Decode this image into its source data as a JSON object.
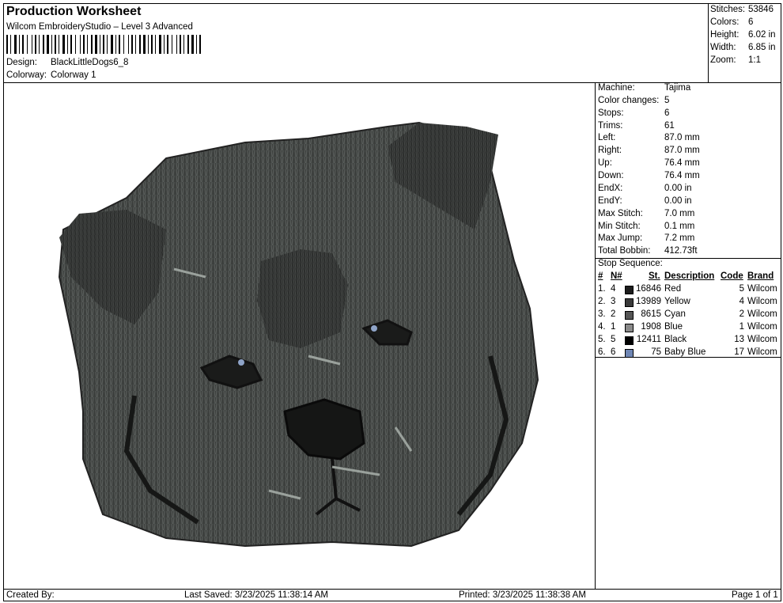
{
  "header": {
    "title": "Production Worksheet",
    "software": "Wilcom EmbroideryStudio – Level 3 Advanced",
    "design_label": "Design:",
    "design_value": "BlackLittleDogs6_8",
    "colorway_label": "Colorway:",
    "colorway_value": "Colorway 1"
  },
  "summary": [
    {
      "label": "Stitches:",
      "value": "53846"
    },
    {
      "label": "Colors:",
      "value": "6"
    },
    {
      "label": "Height:",
      "value": "6.02 in"
    },
    {
      "label": "Width:",
      "value": "6.85 in"
    },
    {
      "label": "Zoom:",
      "value": "1:1"
    }
  ],
  "machine_info": [
    {
      "label": "Machine:",
      "value": "Tajima"
    },
    {
      "label": "Color changes:",
      "value": "5"
    },
    {
      "label": "Stops:",
      "value": "6"
    },
    {
      "label": "Trims:",
      "value": "61"
    },
    {
      "label": "Left:",
      "value": "87.0 mm"
    },
    {
      "label": "Right:",
      "value": "87.0 mm"
    },
    {
      "label": "Up:",
      "value": "76.4 mm"
    },
    {
      "label": "Down:",
      "value": "76.4 mm"
    },
    {
      "label": "EndX:",
      "value": "0.00 in"
    },
    {
      "label": "EndY:",
      "value": "0.00 in"
    },
    {
      "label": "Max Stitch:",
      "value": "7.0 mm"
    },
    {
      "label": "Min Stitch:",
      "value": "0.1 mm"
    },
    {
      "label": "Max Jump:",
      "value": "7.2 mm"
    },
    {
      "label": "Total Bobbin:",
      "value": "412.73ft"
    }
  ],
  "stop_sequence": {
    "title": "Stop Sequence:",
    "headers": {
      "num": "#",
      "n": "N#",
      "st": "St.",
      "desc": "Description",
      "code": "Code",
      "brand": "Brand"
    },
    "rows": [
      {
        "num": "1.",
        "n": "4",
        "color": "#1c1c1c",
        "st": "16846",
        "desc": "Red",
        "code": "5",
        "brand": "Wilcom"
      },
      {
        "num": "2.",
        "n": "3",
        "color": "#3a3a3a",
        "st": "13989",
        "desc": "Yellow",
        "code": "4",
        "brand": "Wilcom"
      },
      {
        "num": "3.",
        "n": "2",
        "color": "#565656",
        "st": "8615",
        "desc": "Cyan",
        "code": "2",
        "brand": "Wilcom"
      },
      {
        "num": "4.",
        "n": "1",
        "color": "#8a8a8a",
        "st": "1908",
        "desc": "Blue",
        "code": "1",
        "brand": "Wilcom"
      },
      {
        "num": "5.",
        "n": "5",
        "color": "#000000",
        "st": "12411",
        "desc": "Black",
        "code": "13",
        "brand": "Wilcom"
      },
      {
        "num": "6.",
        "n": "6",
        "color": "#6f86b4",
        "st": "75",
        "desc": "Baby Blue",
        "code": "17",
        "brand": "Wilcom"
      }
    ]
  },
  "footer": {
    "created_by": "Created By:",
    "last_saved": "Last Saved: 3/23/2025 11:38:14 AM",
    "printed": "Printed: 3/23/2025 11:38:38 AM",
    "page": "Page 1 of 1"
  }
}
